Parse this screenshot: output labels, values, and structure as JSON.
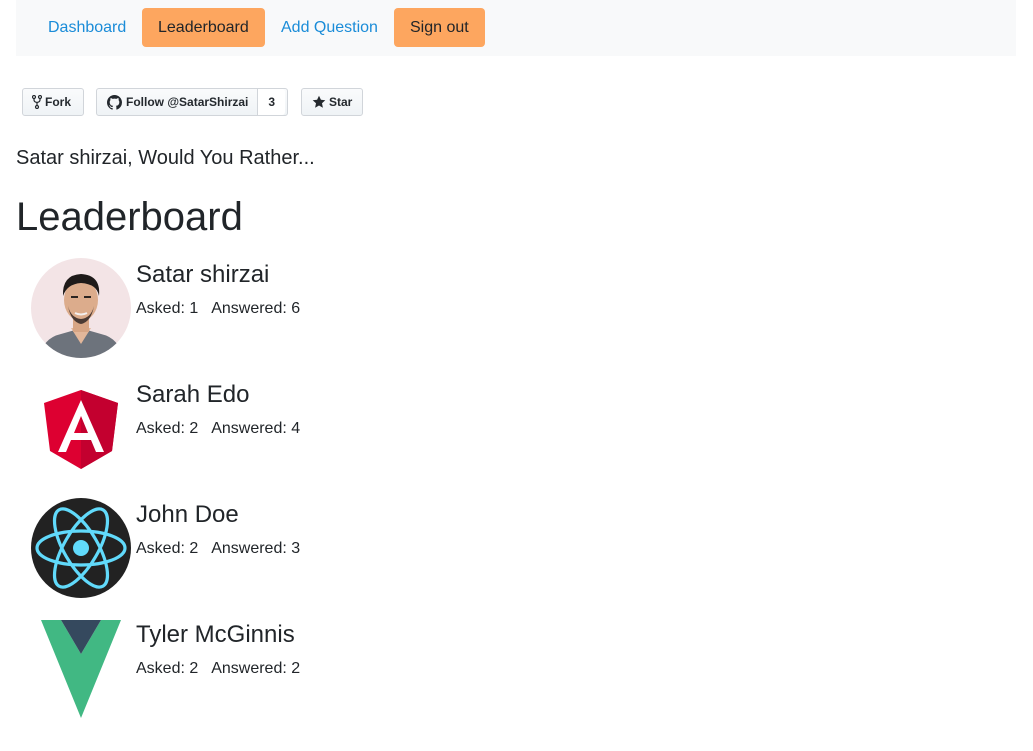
{
  "nav": {
    "items": [
      {
        "label": "Dashboard",
        "active": false
      },
      {
        "label": "Leaderboard",
        "active": true
      },
      {
        "label": "Add Question",
        "active": false
      },
      {
        "label": "Sign out",
        "active": true
      }
    ]
  },
  "github": {
    "fork_label": "Fork",
    "follow_label": "Follow @SatarShirzai",
    "follow_count": "3",
    "star_label": "Star"
  },
  "tagline": "Satar shirzai, Would You Rather...",
  "page_title": "Leaderboard",
  "users": [
    {
      "name": "Satar shirzai",
      "asked_label": "Asked:",
      "asked": "1",
      "answered_label": "Answered:",
      "answered": "6",
      "avatar": "photo-avatar"
    },
    {
      "name": "Sarah Edo",
      "asked_label": "Asked:",
      "asked": "2",
      "answered_label": "Answered:",
      "answered": "4",
      "avatar": "angular-logo"
    },
    {
      "name": "John Doe",
      "asked_label": "Asked:",
      "asked": "2",
      "answered_label": "Answered:",
      "answered": "3",
      "avatar": "react-logo"
    },
    {
      "name": "Tyler McGinnis",
      "asked_label": "Asked:",
      "asked": "2",
      "answered_label": "Answered:",
      "answered": "2",
      "avatar": "vue-logo"
    }
  ],
  "colors": {
    "nav_active": "#fda65f",
    "nav_link": "#1a8cd8",
    "angular_red": "#dd0031",
    "react_blue": "#61dafb",
    "vue_green": "#41b883",
    "vue_dark": "#35495e"
  }
}
